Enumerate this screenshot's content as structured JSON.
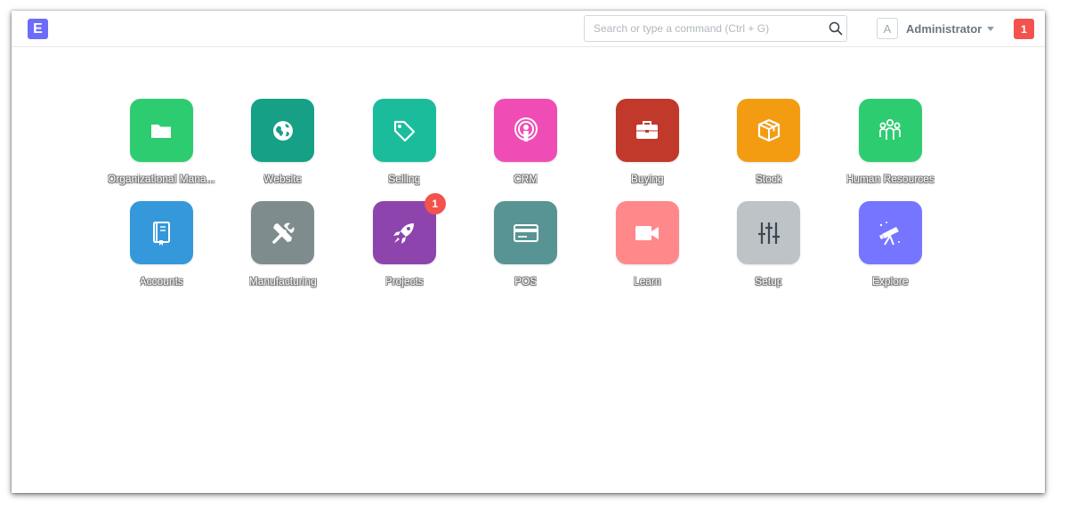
{
  "brand": {
    "letter": "E",
    "color": "#6c6cf8"
  },
  "search": {
    "placeholder": "Search or type a command (Ctrl + G)",
    "value": ""
  },
  "user": {
    "avatar_letter": "A",
    "name": "Administrator"
  },
  "notifications": {
    "count": "1",
    "color": "#f4524d"
  },
  "modules": [
    {
      "label": "Organizational Mana...",
      "color": "#2ecc71",
      "icon": "folder-icon"
    },
    {
      "label": "Website",
      "color": "#16a085",
      "icon": "globe-icon"
    },
    {
      "label": "Selling",
      "color": "#1abc9c",
      "icon": "tag-icon"
    },
    {
      "label": "CRM",
      "color": "#ef4db5",
      "icon": "broadcast-icon"
    },
    {
      "label": "Buying",
      "color": "#c0392b",
      "icon": "briefcase-icon"
    },
    {
      "label": "Stock",
      "color": "#f39c12",
      "icon": "box-icon"
    },
    {
      "label": "Human Resources",
      "color": "#2ecc71",
      "icon": "people-icon"
    },
    {
      "label": "Accounts",
      "color": "#3498db",
      "icon": "book-icon"
    },
    {
      "label": "Manufacturing",
      "color": "#7f8c8d",
      "icon": "tools-icon"
    },
    {
      "label": "Projects",
      "color": "#8e44ad",
      "icon": "rocket-icon",
      "badge": "1"
    },
    {
      "label": "POS",
      "color": "#589494",
      "icon": "card-icon"
    },
    {
      "label": "Learn",
      "color": "#ff888b",
      "icon": "video-camera-icon"
    },
    {
      "label": "Setup",
      "color": "#bdc3c7",
      "icon": "sliders-icon"
    },
    {
      "label": "Explore",
      "color": "#7575ff",
      "icon": "telescope-icon"
    }
  ]
}
